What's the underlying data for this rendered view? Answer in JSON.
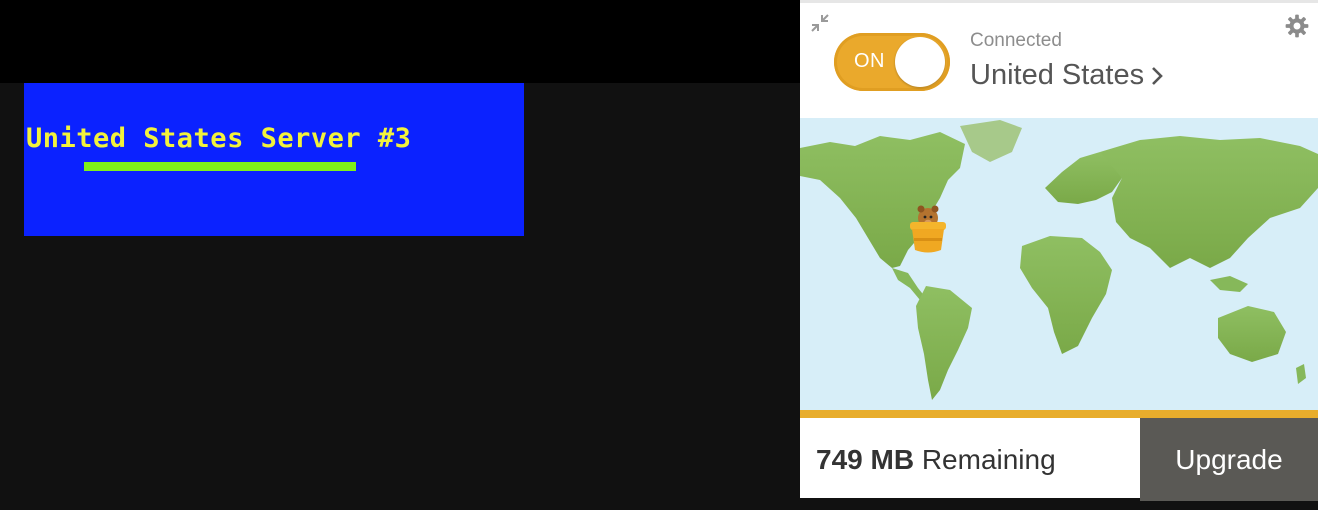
{
  "banner": {
    "server_title": "United States Server #3"
  },
  "vpn": {
    "toggle_label": "ON",
    "status": "Connected",
    "country": "United States",
    "data_amount": "749 MB",
    "data_suffix": "Remaining",
    "upgrade_label": "Upgrade"
  },
  "colors": {
    "banner_bg": "#0b22ff",
    "banner_text": "#f2f23c",
    "accent": "#eaa92c",
    "upgrade_bg": "#5a5955"
  },
  "icons": {
    "collapse": "collapse-arrows-icon",
    "settings": "gear-icon",
    "chevron": "chevron-right-icon",
    "mascot": "bear-in-barrel-icon"
  }
}
